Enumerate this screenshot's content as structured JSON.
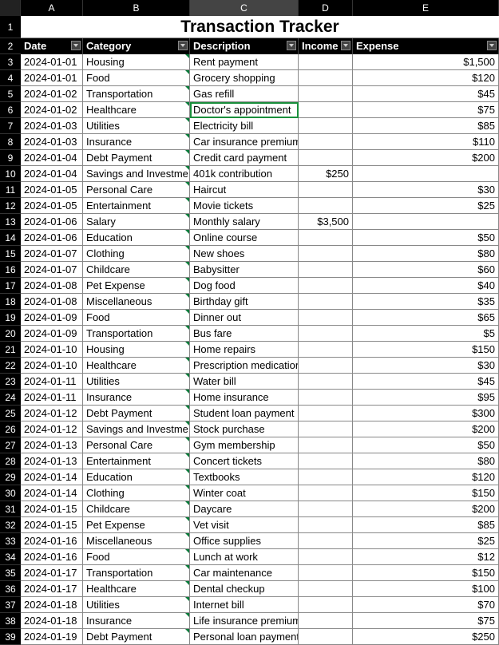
{
  "title": "Transaction Tracker",
  "columns": [
    "A",
    "B",
    "C",
    "D",
    "E"
  ],
  "selectedColumn": "C",
  "headers": [
    "Date",
    "Category",
    "Description",
    "Income",
    "Expense"
  ],
  "activeRow": 6,
  "activeCol": 3,
  "rows": [
    {
      "n": 3,
      "date": "2024-01-01",
      "cat": "Housing",
      "desc": "Rent payment",
      "inc": "",
      "exp": "$1,500"
    },
    {
      "n": 4,
      "date": "2024-01-01",
      "cat": "Food",
      "desc": "Grocery shopping",
      "inc": "",
      "exp": "$120"
    },
    {
      "n": 5,
      "date": "2024-01-02",
      "cat": "Transportation",
      "desc": "Gas refill",
      "inc": "",
      "exp": "$45"
    },
    {
      "n": 6,
      "date": "2024-01-02",
      "cat": "Healthcare",
      "desc": "Doctor's appointment",
      "inc": "",
      "exp": "$75"
    },
    {
      "n": 7,
      "date": "2024-01-03",
      "cat": "Utilities",
      "desc": "Electricity bill",
      "inc": "",
      "exp": "$85"
    },
    {
      "n": 8,
      "date": "2024-01-03",
      "cat": "Insurance",
      "desc": "Car insurance premium",
      "inc": "",
      "exp": "$110"
    },
    {
      "n": 9,
      "date": "2024-01-04",
      "cat": "Debt Payment",
      "desc": "Credit card payment",
      "inc": "",
      "exp": "$200"
    },
    {
      "n": 10,
      "date": "2024-01-04",
      "cat": "Savings and Investme",
      "desc": "401k contribution",
      "inc": "$250",
      "exp": ""
    },
    {
      "n": 11,
      "date": "2024-01-05",
      "cat": "Personal Care",
      "desc": "Haircut",
      "inc": "",
      "exp": "$30"
    },
    {
      "n": 12,
      "date": "2024-01-05",
      "cat": "Entertainment",
      "desc": "Movie tickets",
      "inc": "",
      "exp": "$25"
    },
    {
      "n": 13,
      "date": "2024-01-06",
      "cat": "Salary",
      "desc": "Monthly salary",
      "inc": "$3,500",
      "exp": ""
    },
    {
      "n": 14,
      "date": "2024-01-06",
      "cat": "Education",
      "desc": "Online course",
      "inc": "",
      "exp": "$50"
    },
    {
      "n": 15,
      "date": "2024-01-07",
      "cat": "Clothing",
      "desc": "New shoes",
      "inc": "",
      "exp": "$80"
    },
    {
      "n": 16,
      "date": "2024-01-07",
      "cat": "Childcare",
      "desc": "Babysitter",
      "inc": "",
      "exp": "$60"
    },
    {
      "n": 17,
      "date": "2024-01-08",
      "cat": "Pet Expense",
      "desc": "Dog food",
      "inc": "",
      "exp": "$40"
    },
    {
      "n": 18,
      "date": "2024-01-08",
      "cat": "Miscellaneous",
      "desc": "Birthday gift",
      "inc": "",
      "exp": "$35"
    },
    {
      "n": 19,
      "date": "2024-01-09",
      "cat": "Food",
      "desc": "Dinner out",
      "inc": "",
      "exp": "$65"
    },
    {
      "n": 20,
      "date": "2024-01-09",
      "cat": "Transportation",
      "desc": "Bus fare",
      "inc": "",
      "exp": "$5"
    },
    {
      "n": 21,
      "date": "2024-01-10",
      "cat": "Housing",
      "desc": "Home repairs",
      "inc": "",
      "exp": "$150"
    },
    {
      "n": 22,
      "date": "2024-01-10",
      "cat": "Healthcare",
      "desc": "Prescription medication",
      "inc": "",
      "exp": "$30"
    },
    {
      "n": 23,
      "date": "2024-01-11",
      "cat": "Utilities",
      "desc": "Water bill",
      "inc": "",
      "exp": "$45"
    },
    {
      "n": 24,
      "date": "2024-01-11",
      "cat": "Insurance",
      "desc": "Home insurance",
      "inc": "",
      "exp": "$95"
    },
    {
      "n": 25,
      "date": "2024-01-12",
      "cat": "Debt Payment",
      "desc": "Student loan payment",
      "inc": "",
      "exp": "$300"
    },
    {
      "n": 26,
      "date": "2024-01-12",
      "cat": "Savings and Investme",
      "desc": "Stock purchase",
      "inc": "",
      "exp": "$200"
    },
    {
      "n": 27,
      "date": "2024-01-13",
      "cat": "Personal Care",
      "desc": "Gym membership",
      "inc": "",
      "exp": "$50"
    },
    {
      "n": 28,
      "date": "2024-01-13",
      "cat": "Entertainment",
      "desc": "Concert tickets",
      "inc": "",
      "exp": "$80"
    },
    {
      "n": 29,
      "date": "2024-01-14",
      "cat": "Education",
      "desc": "Textbooks",
      "inc": "",
      "exp": "$120"
    },
    {
      "n": 30,
      "date": "2024-01-14",
      "cat": "Clothing",
      "desc": "Winter coat",
      "inc": "",
      "exp": "$150"
    },
    {
      "n": 31,
      "date": "2024-01-15",
      "cat": "Childcare",
      "desc": "Daycare",
      "inc": "",
      "exp": "$200"
    },
    {
      "n": 32,
      "date": "2024-01-15",
      "cat": "Pet Expense",
      "desc": "Vet visit",
      "inc": "",
      "exp": "$85"
    },
    {
      "n": 33,
      "date": "2024-01-16",
      "cat": "Miscellaneous",
      "desc": "Office supplies",
      "inc": "",
      "exp": "$25"
    },
    {
      "n": 34,
      "date": "2024-01-16",
      "cat": "Food",
      "desc": "Lunch at work",
      "inc": "",
      "exp": "$12"
    },
    {
      "n": 35,
      "date": "2024-01-17",
      "cat": "Transportation",
      "desc": "Car maintenance",
      "inc": "",
      "exp": "$150"
    },
    {
      "n": 36,
      "date": "2024-01-17",
      "cat": "Healthcare",
      "desc": "Dental checkup",
      "inc": "",
      "exp": "$100"
    },
    {
      "n": 37,
      "date": "2024-01-18",
      "cat": "Utilities",
      "desc": "Internet bill",
      "inc": "",
      "exp": "$70"
    },
    {
      "n": 38,
      "date": "2024-01-18",
      "cat": "Insurance",
      "desc": "Life insurance premium",
      "inc": "",
      "exp": "$75"
    },
    {
      "n": 39,
      "date": "2024-01-19",
      "cat": "Debt Payment",
      "desc": "Personal loan payment",
      "inc": "",
      "exp": "$250"
    }
  ]
}
